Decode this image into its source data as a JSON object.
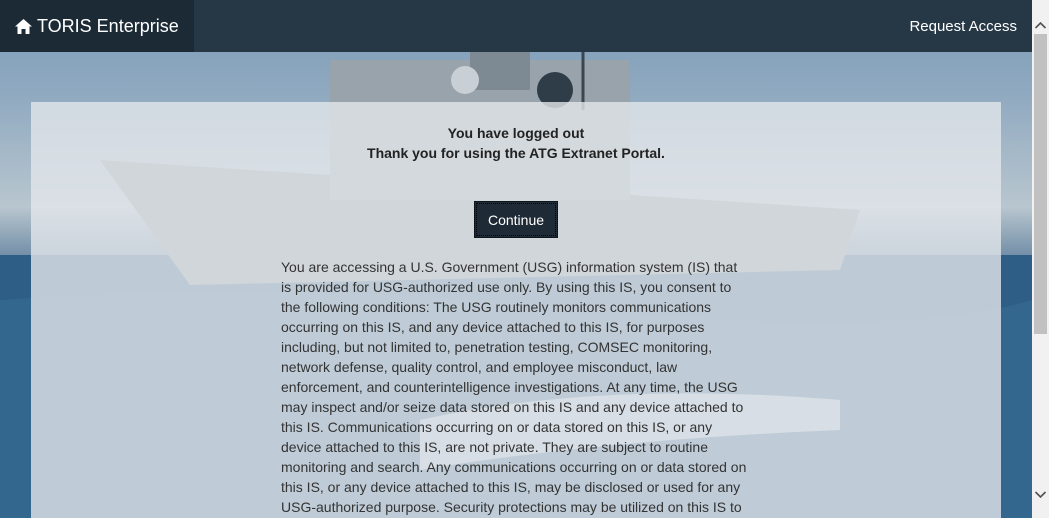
{
  "navbar": {
    "brand_label": "TORIS Enterprise",
    "brand_icon": "home-icon",
    "request_access_label": "Request Access"
  },
  "main": {
    "message_line1": "You have logged out",
    "message_line2": "Thank you for using the ATG Extranet Portal.",
    "continue_label": "Continue",
    "notice_text": "You are accessing a U.S. Government (USG) information system (IS) that is provided for USG-authorized use only. By using this IS, you consent to the following conditions: The USG routinely monitors communications occurring on this IS, and any device attached to this IS, for purposes including, but not limited to, penetration testing, COMSEC monitoring, network defense, quality control, and employee misconduct, law enforcement, and counterintelligence investigations. At any time, the USG may inspect and/or seize data stored on this IS and any device attached to this IS. Communications occurring on or data stored on this IS, or any device attached to this IS, are not private. They are subject to routine monitoring and search. Any communications occurring on or data stored on this IS, or any device attached to this IS, may be disclosed or used for any USG-authorized purpose. Security protections may be utilized on this IS to"
  },
  "colors": {
    "navbar_bg": "#263746",
    "brand_bg": "#1c2a36",
    "button_bg": "#1e2b36"
  }
}
